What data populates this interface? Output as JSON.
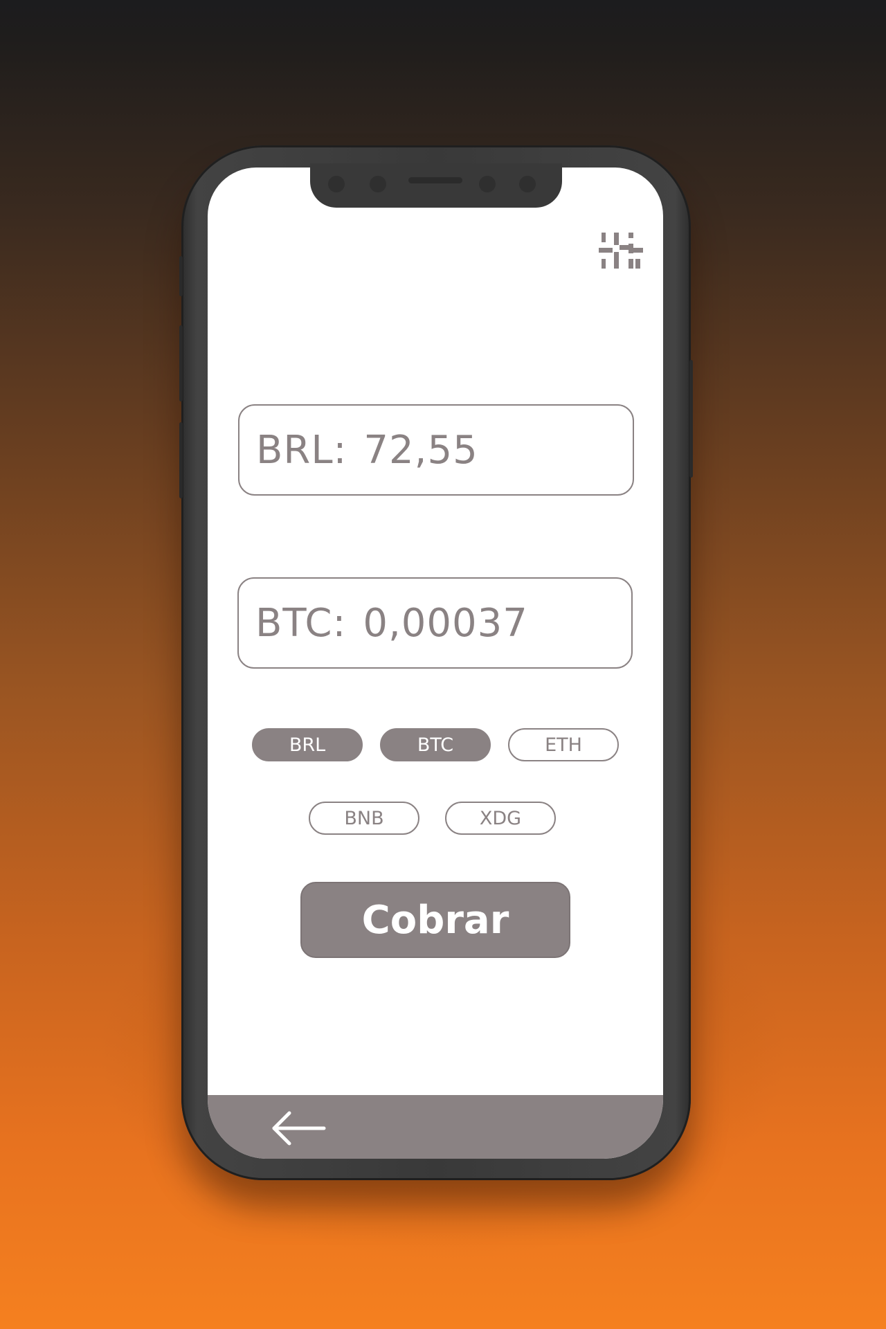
{
  "colors": {
    "accent_gray": "#8a8283",
    "background_top": "#1c1c1e",
    "background_bottom": "#f5801f",
    "phone_frame": "#393939",
    "screen": "#ffffff"
  },
  "header": {
    "settings_icon": "sliders-icon"
  },
  "conversion": {
    "brl_label": "BRL:",
    "brl_value": "72,55",
    "btc_label": "BTC:",
    "btc_value": "0,00037"
  },
  "currencies": [
    {
      "label": "BRL",
      "selected": true
    },
    {
      "label": "BTC",
      "selected": true
    },
    {
      "label": "ETH",
      "selected": false
    },
    {
      "label": "BNB",
      "selected": false
    },
    {
      "label": "XDG",
      "selected": false
    }
  ],
  "actions": {
    "charge_label": "Cobrar"
  },
  "navigation": {
    "back_icon": "arrow-left-icon"
  }
}
